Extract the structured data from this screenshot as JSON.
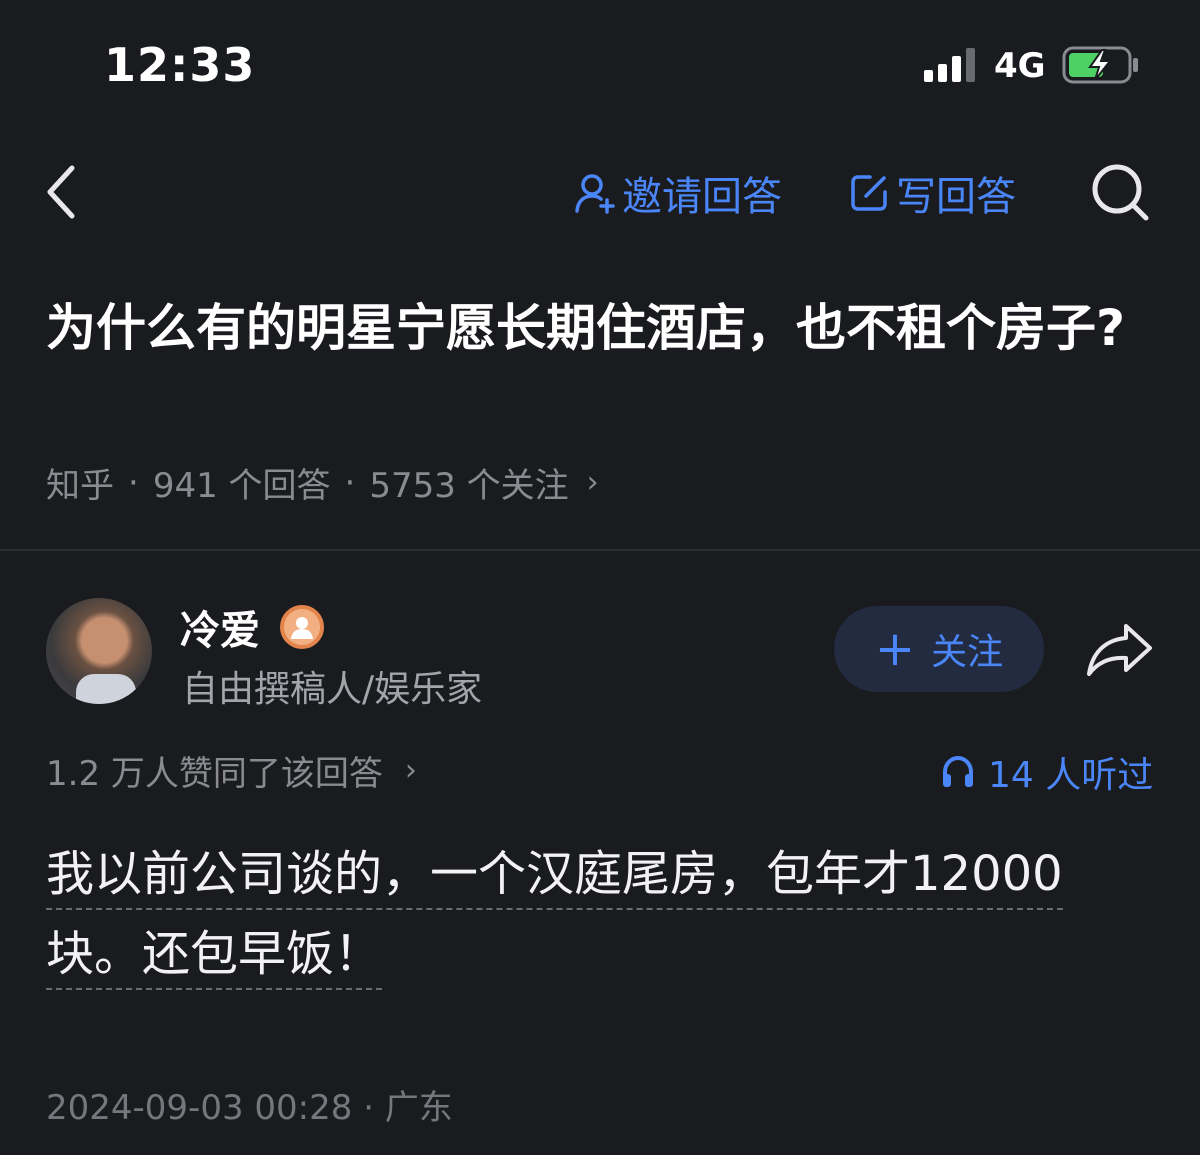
{
  "status_bar": {
    "time": "12:33",
    "network": "4G",
    "battery_color": "#4ed164"
  },
  "nav": {
    "invite_label": "邀请回答",
    "write_label": "写回答",
    "accent_color": "#4a86f7"
  },
  "question": {
    "title": "为什么有的明星宁愿长期住酒店，也不租个房子?",
    "source": "知乎",
    "answers": "941 个回答",
    "follows": "5753 个关注"
  },
  "author": {
    "name": "冷爱",
    "description": "自由撰稿人/娱乐家",
    "follow_label": "关注"
  },
  "answer": {
    "votes": "1.2 万人赞同了该回答",
    "listens": "14 人听过",
    "content": "我以前公司谈的，一个汉庭尾房，包年才12000块。还包早饭！",
    "datetime": "2024-09-03 00:28 · 广东"
  }
}
